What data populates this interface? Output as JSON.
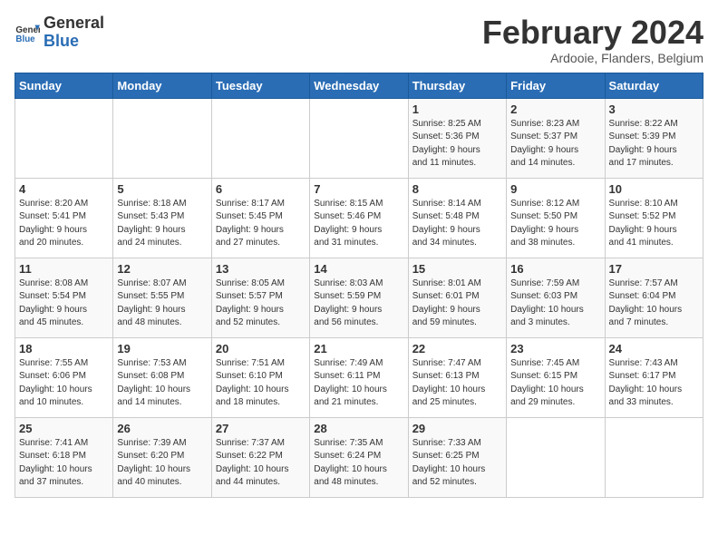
{
  "header": {
    "logo_line1": "General",
    "logo_line2": "Blue",
    "month": "February 2024",
    "location": "Ardooie, Flanders, Belgium"
  },
  "days_of_week": [
    "Sunday",
    "Monday",
    "Tuesday",
    "Wednesday",
    "Thursday",
    "Friday",
    "Saturday"
  ],
  "weeks": [
    [
      {
        "day": "",
        "info": ""
      },
      {
        "day": "",
        "info": ""
      },
      {
        "day": "",
        "info": ""
      },
      {
        "day": "",
        "info": ""
      },
      {
        "day": "1",
        "info": "Sunrise: 8:25 AM\nSunset: 5:36 PM\nDaylight: 9 hours\nand 11 minutes."
      },
      {
        "day": "2",
        "info": "Sunrise: 8:23 AM\nSunset: 5:37 PM\nDaylight: 9 hours\nand 14 minutes."
      },
      {
        "day": "3",
        "info": "Sunrise: 8:22 AM\nSunset: 5:39 PM\nDaylight: 9 hours\nand 17 minutes."
      }
    ],
    [
      {
        "day": "4",
        "info": "Sunrise: 8:20 AM\nSunset: 5:41 PM\nDaylight: 9 hours\nand 20 minutes."
      },
      {
        "day": "5",
        "info": "Sunrise: 8:18 AM\nSunset: 5:43 PM\nDaylight: 9 hours\nand 24 minutes."
      },
      {
        "day": "6",
        "info": "Sunrise: 8:17 AM\nSunset: 5:45 PM\nDaylight: 9 hours\nand 27 minutes."
      },
      {
        "day": "7",
        "info": "Sunrise: 8:15 AM\nSunset: 5:46 PM\nDaylight: 9 hours\nand 31 minutes."
      },
      {
        "day": "8",
        "info": "Sunrise: 8:14 AM\nSunset: 5:48 PM\nDaylight: 9 hours\nand 34 minutes."
      },
      {
        "day": "9",
        "info": "Sunrise: 8:12 AM\nSunset: 5:50 PM\nDaylight: 9 hours\nand 38 minutes."
      },
      {
        "day": "10",
        "info": "Sunrise: 8:10 AM\nSunset: 5:52 PM\nDaylight: 9 hours\nand 41 minutes."
      }
    ],
    [
      {
        "day": "11",
        "info": "Sunrise: 8:08 AM\nSunset: 5:54 PM\nDaylight: 9 hours\nand 45 minutes."
      },
      {
        "day": "12",
        "info": "Sunrise: 8:07 AM\nSunset: 5:55 PM\nDaylight: 9 hours\nand 48 minutes."
      },
      {
        "day": "13",
        "info": "Sunrise: 8:05 AM\nSunset: 5:57 PM\nDaylight: 9 hours\nand 52 minutes."
      },
      {
        "day": "14",
        "info": "Sunrise: 8:03 AM\nSunset: 5:59 PM\nDaylight: 9 hours\nand 56 minutes."
      },
      {
        "day": "15",
        "info": "Sunrise: 8:01 AM\nSunset: 6:01 PM\nDaylight: 9 hours\nand 59 minutes."
      },
      {
        "day": "16",
        "info": "Sunrise: 7:59 AM\nSunset: 6:03 PM\nDaylight: 10 hours\nand 3 minutes."
      },
      {
        "day": "17",
        "info": "Sunrise: 7:57 AM\nSunset: 6:04 PM\nDaylight: 10 hours\nand 7 minutes."
      }
    ],
    [
      {
        "day": "18",
        "info": "Sunrise: 7:55 AM\nSunset: 6:06 PM\nDaylight: 10 hours\nand 10 minutes."
      },
      {
        "day": "19",
        "info": "Sunrise: 7:53 AM\nSunset: 6:08 PM\nDaylight: 10 hours\nand 14 minutes."
      },
      {
        "day": "20",
        "info": "Sunrise: 7:51 AM\nSunset: 6:10 PM\nDaylight: 10 hours\nand 18 minutes."
      },
      {
        "day": "21",
        "info": "Sunrise: 7:49 AM\nSunset: 6:11 PM\nDaylight: 10 hours\nand 21 minutes."
      },
      {
        "day": "22",
        "info": "Sunrise: 7:47 AM\nSunset: 6:13 PM\nDaylight: 10 hours\nand 25 minutes."
      },
      {
        "day": "23",
        "info": "Sunrise: 7:45 AM\nSunset: 6:15 PM\nDaylight: 10 hours\nand 29 minutes."
      },
      {
        "day": "24",
        "info": "Sunrise: 7:43 AM\nSunset: 6:17 PM\nDaylight: 10 hours\nand 33 minutes."
      }
    ],
    [
      {
        "day": "25",
        "info": "Sunrise: 7:41 AM\nSunset: 6:18 PM\nDaylight: 10 hours\nand 37 minutes."
      },
      {
        "day": "26",
        "info": "Sunrise: 7:39 AM\nSunset: 6:20 PM\nDaylight: 10 hours\nand 40 minutes."
      },
      {
        "day": "27",
        "info": "Sunrise: 7:37 AM\nSunset: 6:22 PM\nDaylight: 10 hours\nand 44 minutes."
      },
      {
        "day": "28",
        "info": "Sunrise: 7:35 AM\nSunset: 6:24 PM\nDaylight: 10 hours\nand 48 minutes."
      },
      {
        "day": "29",
        "info": "Sunrise: 7:33 AM\nSunset: 6:25 PM\nDaylight: 10 hours\nand 52 minutes."
      },
      {
        "day": "",
        "info": ""
      },
      {
        "day": "",
        "info": ""
      }
    ]
  ]
}
